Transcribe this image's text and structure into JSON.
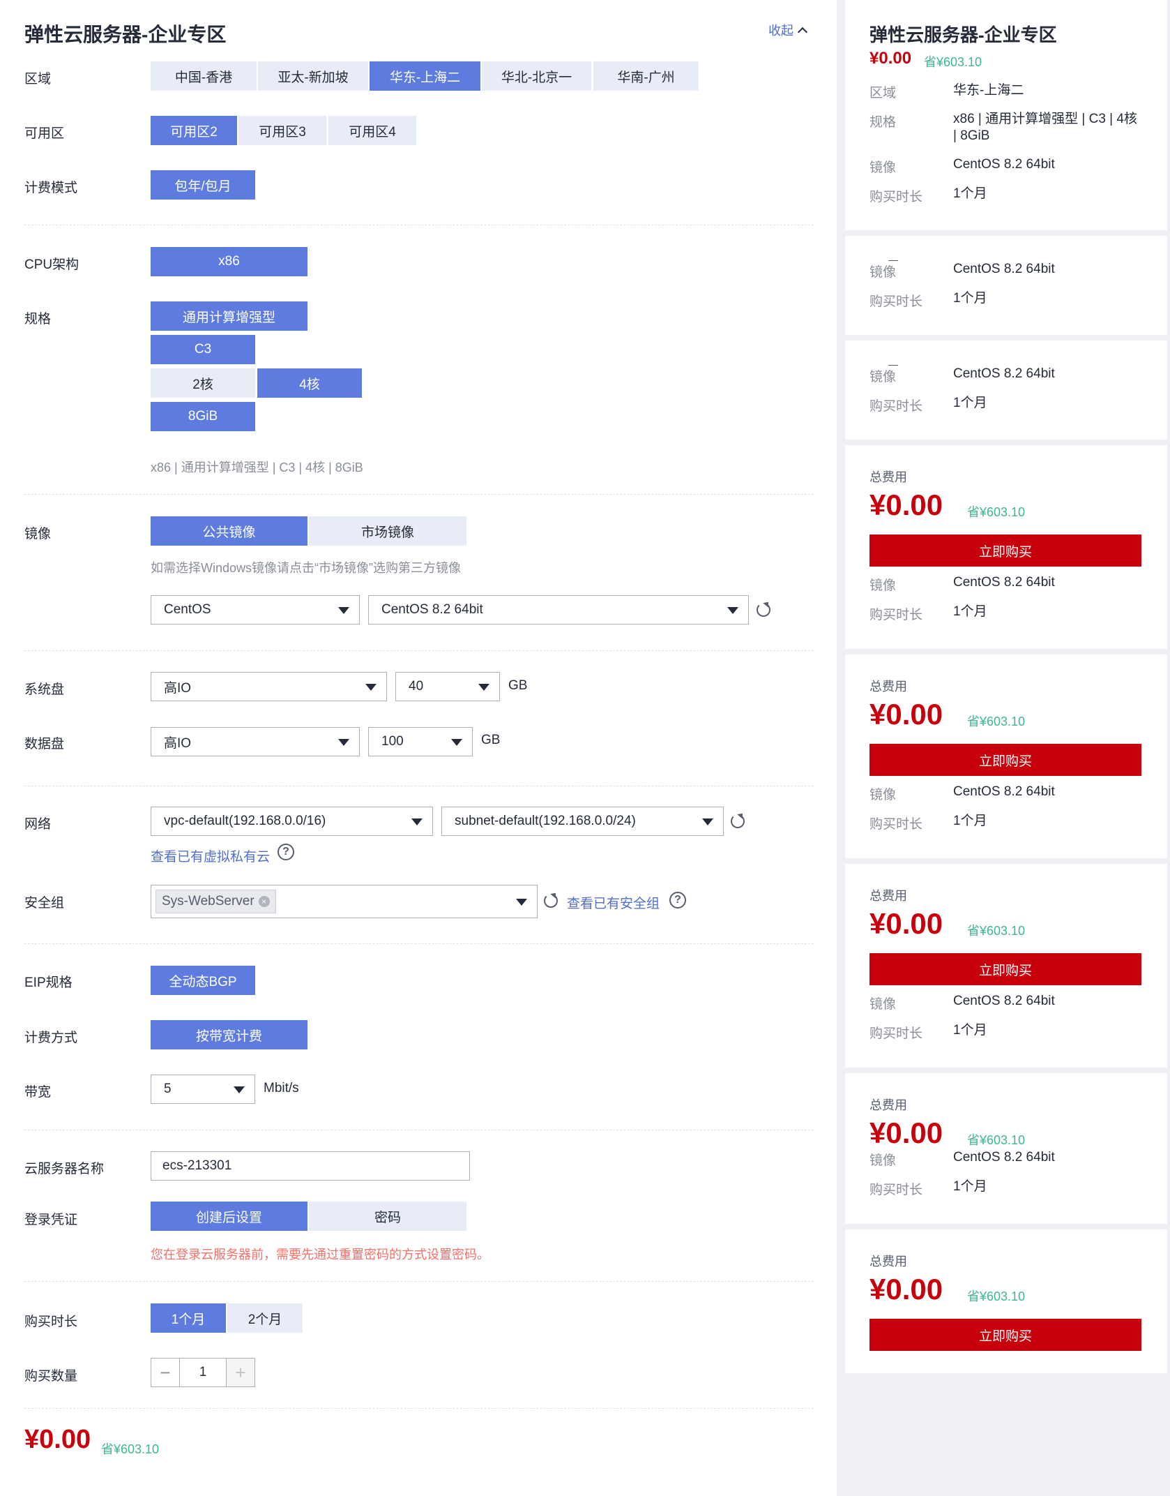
{
  "header": {
    "title": "弹性云服务器-企业专区",
    "collapse_label": "收起"
  },
  "labels": {
    "region": "区域",
    "az": "可用区",
    "billing_mode": "计费模式",
    "cpu_arch": "CPU架构",
    "spec": "规格",
    "image": "镜像",
    "system_disk": "系统盘",
    "data_disk": "数据盘",
    "network": "网络",
    "security_group": "安全组",
    "eip_spec": "EIP规格",
    "charge_method": "计费方式",
    "bandwidth": "带宽",
    "server_name": "云服务器名称",
    "login_credential": "登录凭证",
    "duration": "购买时长",
    "quantity": "购买数量"
  },
  "region": {
    "options": [
      "中国-香港",
      "亚太-新加坡",
      "华东-上海二",
      "华北-北京一",
      "华南-广州"
    ],
    "selected": "华东-上海二"
  },
  "az": {
    "options": [
      "可用区2",
      "可用区3",
      "可用区4"
    ],
    "selected": "可用区2"
  },
  "billing_mode": {
    "options": [
      "包年/包月"
    ],
    "selected": "包年/包月"
  },
  "cpu_arch": {
    "options": [
      "x86"
    ],
    "selected": "x86"
  },
  "spec": {
    "family": "通用计算增强型",
    "generation": "C3",
    "cores": [
      "2核",
      "4核"
    ],
    "cores_selected": "4核",
    "memory": "8GiB",
    "summary": "x86 | 通用计算增强型 | C3 | 4核 | 8GiB"
  },
  "image": {
    "tabs": [
      "公共镜像",
      "市场镜像"
    ],
    "selected_tab": "公共镜像",
    "hint": "如需选择Windows镜像请点击“市场镜像”选购第三方镜像",
    "os": "CentOS",
    "version": "CentOS 8.2 64bit"
  },
  "system_disk": {
    "type": "高IO",
    "size": "40",
    "unit": "GB"
  },
  "data_disk": {
    "type": "高IO",
    "size": "100",
    "unit": "GB"
  },
  "network": {
    "vpc": "vpc-default(192.168.0.0/16)",
    "subnet": "subnet-default(192.168.0.0/24)",
    "view_vpc_link": "查看已有虚拟私有云"
  },
  "security_group": {
    "tag": "Sys-WebServer",
    "view_link": "查看已有安全组"
  },
  "eip": {
    "spec": "全动态BGP",
    "charge": "按带宽计费",
    "bandwidth": "5",
    "bandwidth_unit": "Mbit/s"
  },
  "server_name": {
    "value": "ecs-213301"
  },
  "login": {
    "options": [
      "创建后设置",
      "密码"
    ],
    "selected": "创建后设置",
    "warning": "您在登录云服务器前，需要先通过重置密码的方式设置密码。"
  },
  "duration": {
    "options": [
      "1个月",
      "2个月"
    ],
    "selected": "1个月"
  },
  "quantity": {
    "value": "1",
    "minus": "−",
    "plus": "+"
  },
  "footer": {
    "price": "¥0.00",
    "save": "省¥603.10"
  },
  "summary": {
    "title": "弹性云服务器-企业专区",
    "price": "¥0.00",
    "save": "省¥603.10",
    "region_key": "区域",
    "region_val": "华东-上海二",
    "spec_key": "规格",
    "spec_val": "x86 | 通用计算增强型 | C3 | 4核 | 8GiB",
    "image_key": "镜像",
    "image_val": "CentOS 8.2 64bit",
    "duration_key": "购买时长",
    "duration_val": "1个月",
    "total_label": "总费用",
    "buy_label": "立即购买"
  },
  "colors": {
    "primary": "#5e7ce0",
    "price_red": "#c7000b",
    "save_green": "#3bb892",
    "link": "#526ecc",
    "warning": "#f66f6a"
  }
}
